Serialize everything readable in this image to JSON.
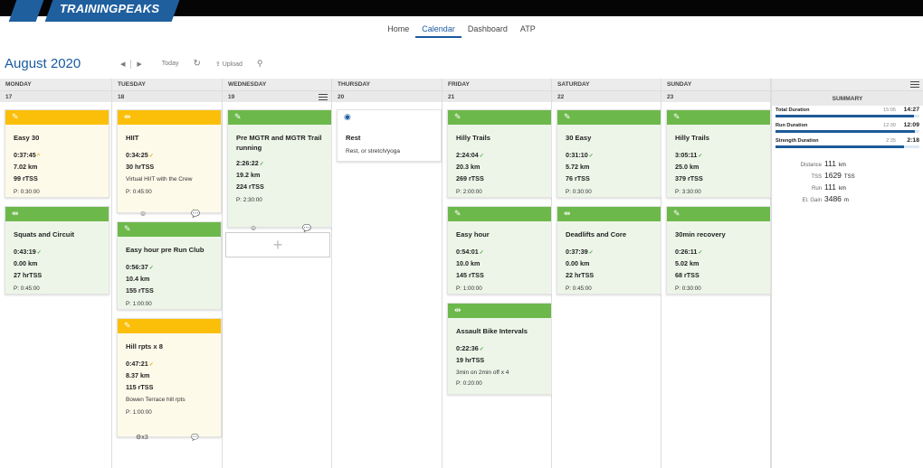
{
  "app": {
    "logo": "TRAININGPEAKS"
  },
  "nav": {
    "items": [
      "Home",
      "Calendar",
      "Dashboard",
      "ATP"
    ],
    "active": "Calendar"
  },
  "header": {
    "month": "August",
    "year": "2020"
  },
  "toolbar": {
    "today": "Today",
    "upload": "Upload"
  },
  "days": [
    {
      "name": "MONDAY",
      "date": "17"
    },
    {
      "name": "TUESDAY",
      "date": "18"
    },
    {
      "name": "WEDNESDAY",
      "date": "19"
    },
    {
      "name": "THURSDAY",
      "date": "20"
    },
    {
      "name": "FRIDAY",
      "date": "21"
    },
    {
      "name": "SATURDAY",
      "date": "22"
    },
    {
      "name": "SUNDAY",
      "date": "23"
    }
  ],
  "workouts": {
    "mon1": {
      "title": "Easy 30",
      "duration": "0:37:45",
      "distance": "7.02 km",
      "load": "99 rTSS",
      "planned": "P: 0:30:00"
    },
    "mon2": {
      "title": "Squats and Circuit",
      "duration": "0:43:19",
      "distance": "0.00 km",
      "load": "27 hrTSS",
      "planned": "P: 0:45:00"
    },
    "tue1": {
      "title": "HIIT",
      "duration": "0:34:25",
      "load": "30 hrTSS",
      "note": "Virtual HIIT with the Crew",
      "planned": "P: 0:45:00"
    },
    "tue2": {
      "title": "Easy hour pre Run Club",
      "duration": "0:56:37",
      "distance": "10.4 km",
      "load": "155 rTSS",
      "planned": "P: 1:00:00"
    },
    "tue3": {
      "title": "Hill rpts x 8",
      "duration": "0:47:21",
      "distance": "8.37 km",
      "load": "115 rTSS",
      "note": "Bowen Terrace hill rpts",
      "planned": "P: 1:00:00",
      "count": "x3"
    },
    "wed1": {
      "title": "Pre MGTR and MGTR Trail running",
      "duration": "2:26:22",
      "distance": "19.2 km",
      "load": "224 rTSS",
      "planned": "P: 2:30:00"
    },
    "thu1": {
      "title": "Rest",
      "note": "Rest, or stretch/yoga"
    },
    "fri1": {
      "title": "Hilly Trails",
      "duration": "2:24:04",
      "distance": "20.3 km",
      "load": "269 rTSS",
      "planned": "P: 2:00:00"
    },
    "fri2": {
      "title": "Easy hour",
      "duration": "0:54:01",
      "distance": "10.0 km",
      "load": "145 rTSS",
      "planned": "P: 1:00:00"
    },
    "fri3": {
      "title": "Assault Bike Intervals",
      "duration": "0:22:36",
      "load": "19 hrTSS",
      "note": "3min on 2min off x 4",
      "planned": "P: 0:20:00"
    },
    "sat1": {
      "title": "30 Easy",
      "duration": "0:31:10",
      "distance": "5.72 km",
      "load": "76 rTSS",
      "planned": "P: 0:30:00"
    },
    "sat2": {
      "title": "Deadlifts and Core",
      "duration": "0:37:39",
      "distance": "0.00 km",
      "load": "22 hrTSS",
      "planned": "P: 0:45:00"
    },
    "sun1": {
      "title": "Hilly Trails",
      "duration": "3:05:11",
      "distance": "25.0 km",
      "load": "379 rTSS",
      "planned": "P: 3:30:00"
    },
    "sun2": {
      "title": "30min recovery",
      "duration": "0:26:11",
      "distance": "5.02 km",
      "load": "68 rTSS",
      "planned": "P: 0:30:00"
    }
  },
  "summary": {
    "title": "SUMMARY",
    "rows": [
      {
        "label": "Total Duration",
        "planned": "15:05",
        "actual": "14:27",
        "progress": 0.96
      },
      {
        "label": "Run Duration",
        "planned": "12:30",
        "actual": "12:09",
        "progress": 0.97
      },
      {
        "label": "Strength Duration",
        "planned": "2:35",
        "actual": "2:18",
        "progress": 0.89
      }
    ],
    "stats": [
      {
        "label": "Distance",
        "value": "111",
        "unit": "km"
      },
      {
        "label": "TSS",
        "value": "1629",
        "unit": "TSS"
      },
      {
        "label": "Run",
        "value": "111",
        "unit": "km"
      },
      {
        "label": "El. Gain",
        "value": "3486",
        "unit": "m"
      }
    ]
  },
  "colors": {
    "green": "#6cb84b",
    "yellow": "#fbbf0a",
    "blue": "#1a5aa0"
  }
}
